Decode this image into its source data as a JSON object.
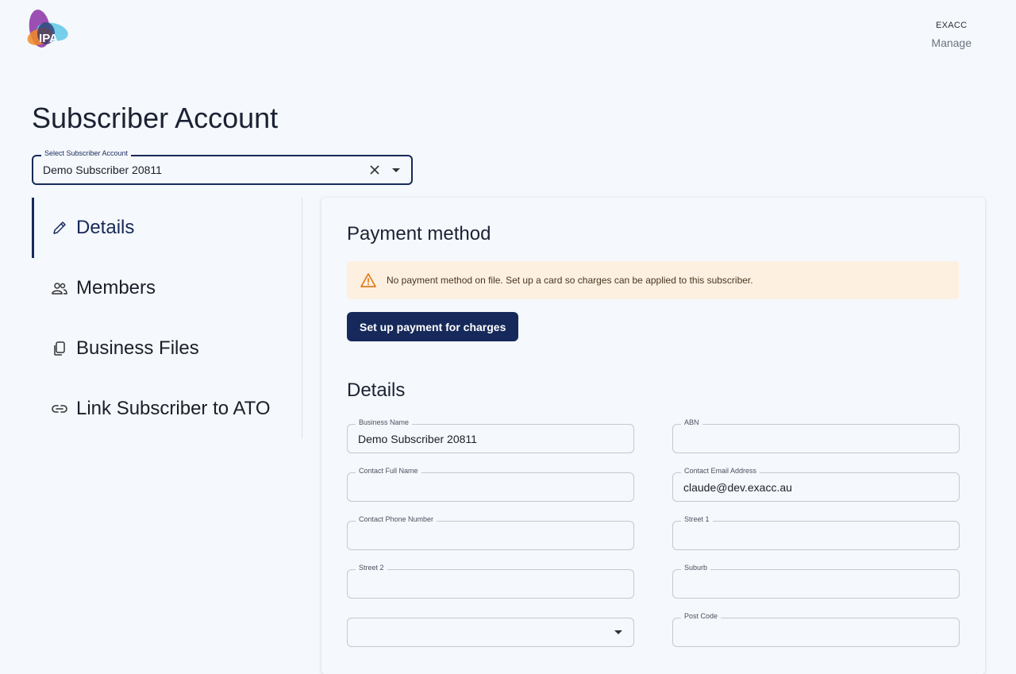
{
  "header": {
    "logo_text": "IPA",
    "user_name": "EXACC",
    "manage_label": "Manage"
  },
  "page": {
    "title": "Subscriber Account"
  },
  "subscriber_select": {
    "label": "Select Subscriber Account",
    "value": "Demo Subscriber 20811"
  },
  "sidebar": {
    "items": [
      {
        "label": "Details",
        "icon": "pencil-icon",
        "active": true
      },
      {
        "label": "Members",
        "icon": "users-icon",
        "active": false
      },
      {
        "label": "Business Files",
        "icon": "files-icon",
        "active": false
      },
      {
        "label": "Link Subscriber to ATO",
        "icon": "link-icon",
        "active": false
      }
    ]
  },
  "payment": {
    "title": "Payment method",
    "alert_text": "No payment method on file. Set up a card so charges can be applied to this subscriber.",
    "alert_icon": "warning-icon",
    "button_label": "Set up payment for charges"
  },
  "details": {
    "title": "Details",
    "fields": {
      "business_name": {
        "label": "Business Name",
        "value": "Demo Subscriber 20811"
      },
      "abn": {
        "label": "ABN",
        "value": ""
      },
      "contact_full_name": {
        "label": "Contact Full Name",
        "value": ""
      },
      "contact_email": {
        "label": "Contact Email Address",
        "value": "claude@dev.exacc.au"
      },
      "contact_phone": {
        "label": "Contact Phone Number",
        "value": ""
      },
      "street1": {
        "label": "Street 1",
        "value": ""
      },
      "street2": {
        "label": "Street 2",
        "value": ""
      },
      "suburb": {
        "label": "Suburb",
        "value": ""
      },
      "state": {
        "label": "",
        "value": ""
      },
      "post_code": {
        "label": "Post Code",
        "value": ""
      }
    }
  },
  "colors": {
    "primary": "#16295a",
    "background": "#f5f8fc",
    "warning_bg": "#fdf0e1",
    "warning_icon": "#e07b1a"
  }
}
